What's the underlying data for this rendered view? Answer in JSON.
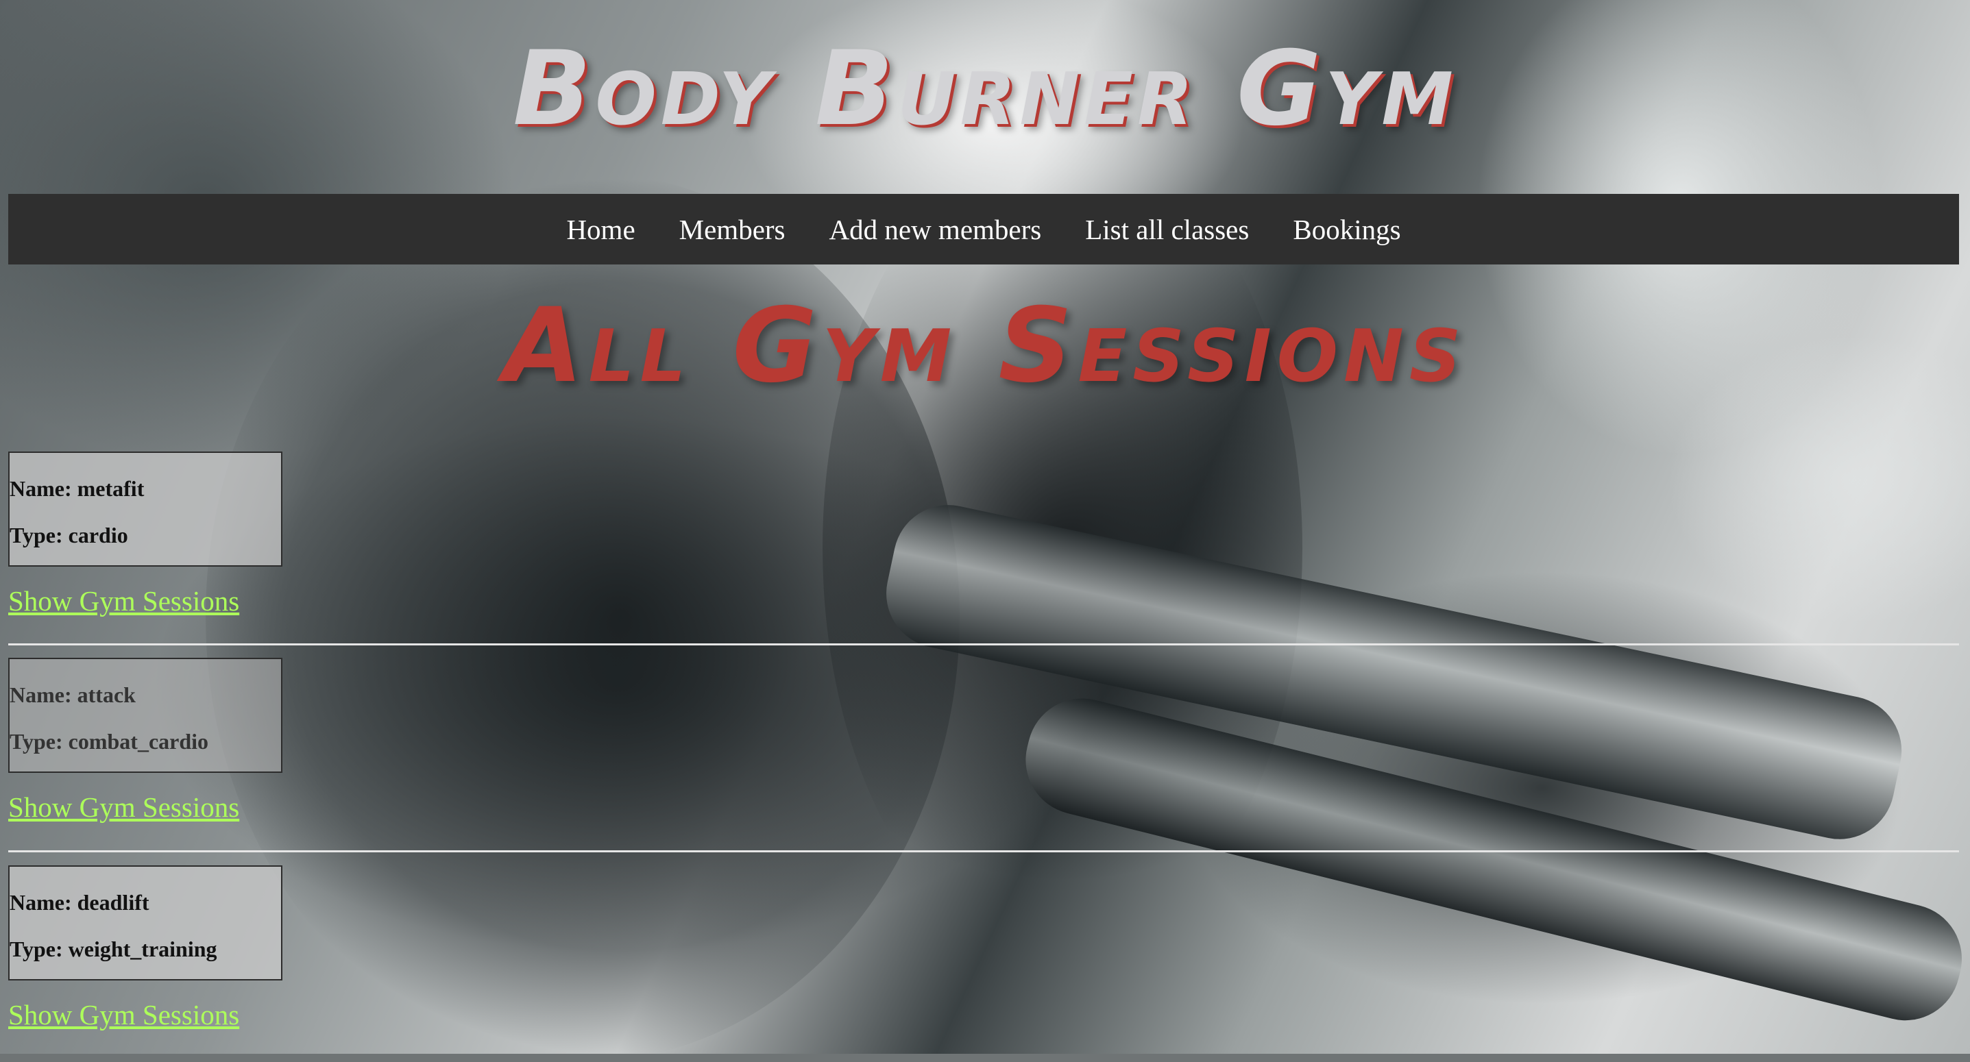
{
  "site": {
    "title": "Body Burner Gym"
  },
  "nav": {
    "items": [
      {
        "label": "Home"
      },
      {
        "label": "Members"
      },
      {
        "label": "Add new members"
      },
      {
        "label": "List all classes"
      },
      {
        "label": "Bookings"
      }
    ]
  },
  "page": {
    "heading": "All Gym Sessions"
  },
  "sessions": [
    {
      "name": "Name: metafit",
      "type": "Type: cardio",
      "link": "Show Gym Sessions"
    },
    {
      "name": "Name: attack",
      "type": "Type: combat_cardio",
      "link": "Show Gym Sessions"
    },
    {
      "name": "Name: deadlift",
      "type": "Type: weight_training",
      "link": "Show Gym Sessions"
    }
  ],
  "colors": {
    "nav_bg": "#2f2f2f",
    "heading": "#b83a33",
    "title": "#d3d3d6",
    "link": "#adff5a"
  }
}
